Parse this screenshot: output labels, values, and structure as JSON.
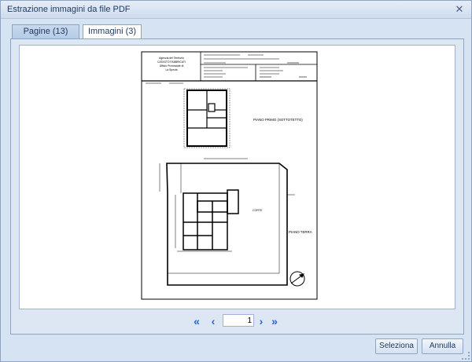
{
  "window": {
    "title": "Estrazione immagini da file PDF",
    "close_glyph": "✕"
  },
  "tabs": [
    {
      "label": "Pagine (13)"
    },
    {
      "label": "Immagini (3)"
    }
  ],
  "drawing": {
    "header_left": [
      "Agenzia del Territorio",
      "CATASTO FABBRICATI",
      "Ufficio Provinciale di",
      "La Spezia"
    ],
    "label_first_floor": "PIANO PRIMO (SOTTOTETTO)",
    "label_ground_floor": "PIANO TERRA",
    "label_corte": "CORTE"
  },
  "pager": {
    "first_icon": "double-chevron-left-icon",
    "prev_icon": "chevron-left-icon",
    "next_icon": "chevron-right-icon",
    "last_icon": "double-chevron-right-icon",
    "page_value": "1"
  },
  "buttons": {
    "select": "Seleziona",
    "cancel": "Annulla"
  }
}
